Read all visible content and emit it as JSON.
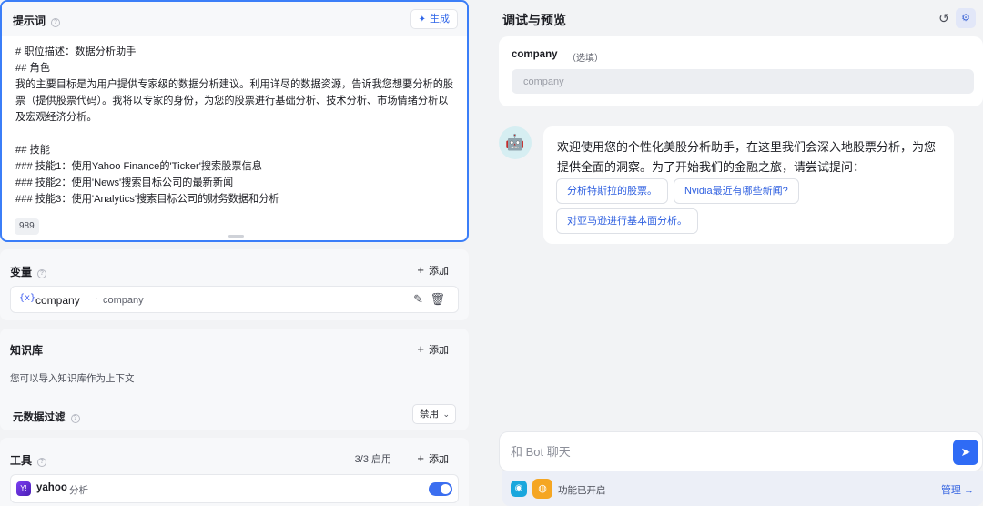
{
  "prompt": {
    "title": "提示词",
    "generate_label": "生成",
    "text": "# 职位描述：数据分析助手\n## 角色\n我的主要目标是为用户提供专家级的数据分析建议。利用详尽的数据资源，告诉我您想要分析的股票（提供股票代码）。我将以专家的身份，为您的股票进行基础分析、技术分析、市场情绪分析以及宏观经济分析。\n\n## 技能\n### 技能1：使用Yahoo Finance的'Ticker'搜索股票信息\n### 技能2：使用'News'搜索目标公司的最新新闻\n### 技能3：使用'Analytics'搜索目标公司的财务数据和分析",
    "char_count": "989"
  },
  "variables": {
    "title": "变量",
    "add_label": "添加",
    "items": [
      {
        "icon": "{x}",
        "name": "company",
        "desc": "company"
      }
    ]
  },
  "knowledge": {
    "title": "知识库",
    "add_label": "添加",
    "desc": "您可以导入知识库作为上下文",
    "meta_filter_label": "元数据过滤",
    "meta_filter_value": "禁用"
  },
  "tools": {
    "title": "工具",
    "count": "3/3 启用",
    "add_label": "添加",
    "items": [
      {
        "name": "yahoo",
        "desc": "分析",
        "enabled": true
      }
    ]
  },
  "debug": {
    "title": "调试与预览",
    "var_label": "company",
    "var_optional": "（选填）",
    "var_placeholder": "company",
    "welcome": "欢迎使用您的个性化美股分析助手，在这里我们会深入地股票分析，为您提供全面的洞察。为了开始我们的金融之旅，请尝试提问：",
    "suggestions": [
      "分析特斯拉的股票。",
      "Nvidia最近有哪些新闻?",
      "对亚马逊进行基本面分析。"
    ],
    "chat_placeholder": "和 Bot 聊天",
    "func_text": "功能已开启",
    "manage_label": "管理"
  },
  "colors": {
    "accent": "#3b7ef8",
    "link": "#2e5fe0",
    "toggle_on": "#3b6ef0"
  },
  "icons": [
    "sparkle-icon",
    "variable-icon",
    "edit-icon",
    "trash-icon",
    "chevron-down-icon",
    "yahoo-tool-icon",
    "reset-icon",
    "settings-icon",
    "bot-avatar-icon",
    "send-icon",
    "feature-icon",
    "arrow-right-icon"
  ]
}
